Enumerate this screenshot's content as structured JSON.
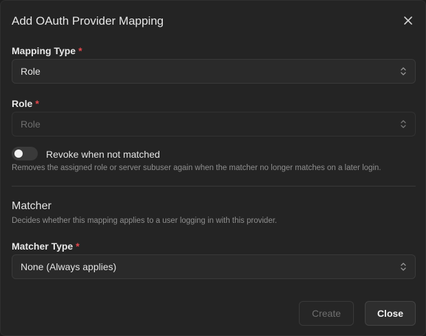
{
  "dialog": {
    "title": "Add OAuth Provider Mapping"
  },
  "fields": {
    "mapping_type": {
      "label": "Mapping Type",
      "required_mark": "*",
      "value": "Role"
    },
    "role": {
      "label": "Role",
      "required_mark": "*",
      "placeholder": "Role"
    },
    "revoke": {
      "label": "Revoke when not matched",
      "enabled": false,
      "description": "Removes the assigned role or server subuser again when the matcher no longer matches on a later login."
    },
    "matcher_section": {
      "title": "Matcher",
      "description": "Decides whether this mapping applies to a user logging in with this provider."
    },
    "matcher_type": {
      "label": "Matcher Type",
      "required_mark": "*",
      "value": "None (Always applies)"
    }
  },
  "buttons": {
    "create": "Create",
    "close": "Close"
  },
  "icons": {
    "close": "close-icon",
    "select_chevron": "chevron-up-down-icon"
  },
  "colors": {
    "background": "#242424",
    "required": "#e5484d",
    "muted_text": "#8f8f8f"
  }
}
